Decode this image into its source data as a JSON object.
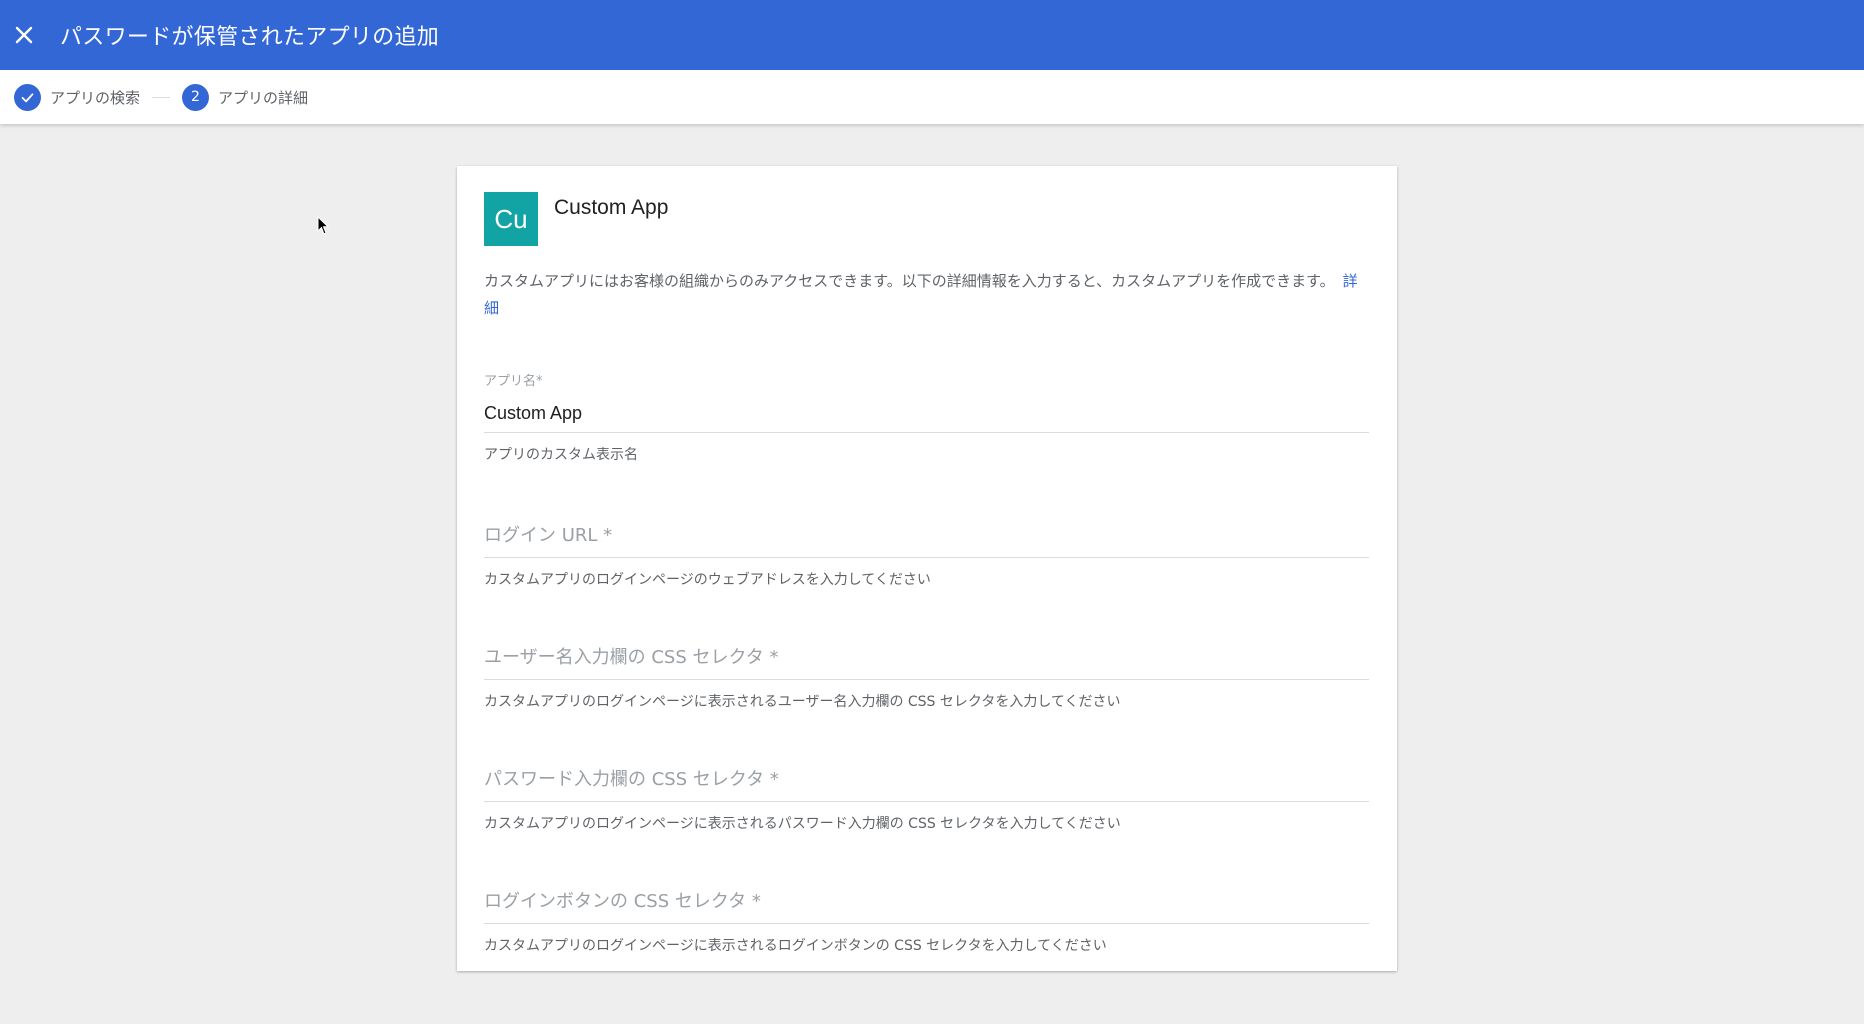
{
  "header": {
    "close_icon": "close-icon",
    "title": "パスワードが保管されたアプリの追加"
  },
  "stepper": {
    "steps": [
      {
        "label": "アプリの検索",
        "state": "complete",
        "icon": "check-icon"
      },
      {
        "label": "アプリの詳細",
        "state": "active",
        "number": "2"
      }
    ]
  },
  "app": {
    "avatar_text": "Cu",
    "avatar_color": "#12a4a4",
    "name": "Custom App",
    "description": "カスタムアプリにはお客様の組織からのみアクセスできます。以下の詳細情報を入力すると、カスタムアプリを作成できます。",
    "details_link": "詳細"
  },
  "form": {
    "app_name": {
      "label": "アプリ名*",
      "value": "Custom App",
      "hint": "アプリのカスタム表示名"
    },
    "login_url": {
      "placeholder": "ログイン URL *",
      "hint": "カスタムアプリのログインページのウェブアドレスを入力してください"
    },
    "username_selector": {
      "placeholder": "ユーザー名入力欄の CSS セレクタ *",
      "hint": "カスタムアプリのログインページに表示されるユーザー名入力欄の CSS セレクタを入力してください"
    },
    "password_selector": {
      "placeholder": "パスワード入力欄の CSS セレクタ *",
      "hint": "カスタムアプリのログインページに表示されるパスワード入力欄の CSS セレクタを入力してください"
    },
    "login_button_selector": {
      "placeholder": "ログインボタンの CSS セレクタ *",
      "hint": "カスタムアプリのログインページに表示されるログインボタンの CSS セレクタを入力してください"
    }
  },
  "colors": {
    "header": "#3367d6",
    "accent": "#3367d6",
    "background": "#eeeeee"
  }
}
